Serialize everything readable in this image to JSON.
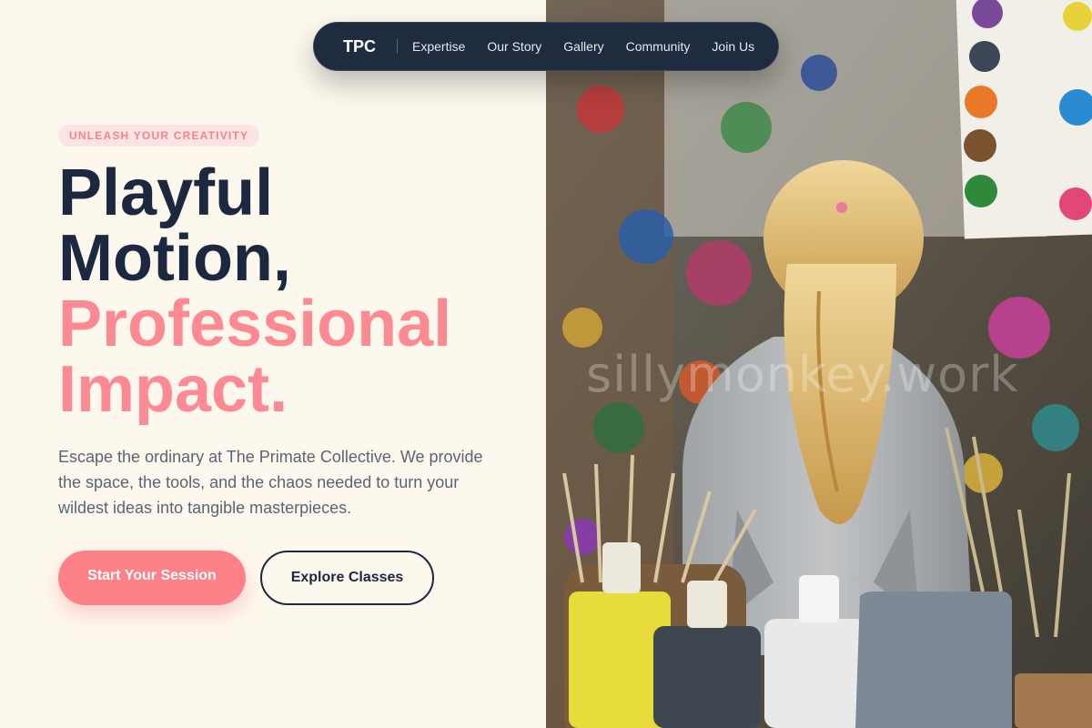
{
  "nav": {
    "brand": "TPC",
    "links": [
      "Expertise",
      "Our Story",
      "Gallery",
      "Community",
      "Join Us"
    ]
  },
  "hero": {
    "eyebrow": "UNLEASH YOUR CREATIVITY",
    "headline": {
      "line1": "Playful",
      "line2": "Motion,",
      "line3": "Professional",
      "line4": "Impact."
    },
    "description": "Escape the ordinary at The Primate Collective. We provide the space, the tools, and the chaos needed to turn your wildest ideas into tangible masterpieces.",
    "primary_cta": "Start Your Session",
    "secondary_cta": "Explore Classes"
  },
  "photo": {
    "watermark": "sillymonkey.work"
  },
  "colors": {
    "background": "#fdf8ee",
    "navy": "#1c2840",
    "accent": "#fd8a92",
    "eyebrow_bg": "#fde4e4",
    "nav_bg": "#1f2b3f"
  }
}
